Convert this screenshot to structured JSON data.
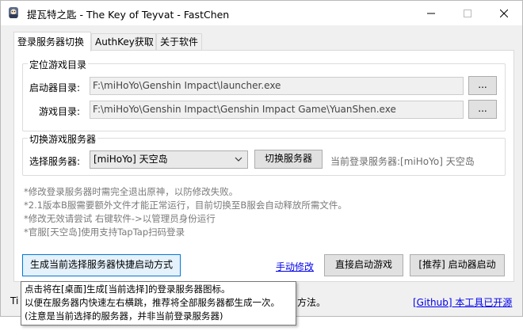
{
  "window": {
    "title": "提瓦特之匙 - The Key of Teyvat - FastChen"
  },
  "titlebar_buttons": {
    "minimize_icon": "minimize-icon",
    "maximize_icon": "maximize-icon",
    "close_icon": "close-icon"
  },
  "tabs": [
    {
      "label": "登录服务器切换",
      "active": true
    },
    {
      "label": "AuthKey获取",
      "active": false
    },
    {
      "label": "关于软件",
      "active": false
    }
  ],
  "locate_group": {
    "title": "定位游戏目录",
    "launcher_label": "启动器目录:",
    "launcher_value": "F:\\miHoYo\\Genshin Impact\\launcher.exe",
    "launcher_browse": "...",
    "game_label": "游戏目录:",
    "game_value": "F:\\miHoYo\\Genshin Impact\\Genshin Impact Game\\YuanShen.exe",
    "game_browse": "..."
  },
  "switch_group": {
    "title": "切换游戏服务器",
    "select_label": "选择服务器:",
    "selected_server": "[miHoYo] 天空岛",
    "switch_button": "切换服务器",
    "current_login": "当前登录服务器:[miHoYo] 天空岛"
  },
  "notes": [
    "*修改登录服务器时需完全退出原神，以防修改失败。",
    "*2.1版本B服需要额外文件才能正常运行，目前切换至B服会自动释放所需文件。",
    "*修改无效请尝试 右键软件->以管理员身份运行",
    "*官服[天空岛]使用支持TapTap扫码登录"
  ],
  "actions": {
    "create_shortcut": "生成当前选择服务器快捷启动方式",
    "manual_edit": "手动修改",
    "direct_launch": "直接启动游戏",
    "launcher_start": "[推荐] 启动器启动"
  },
  "statusbar": {
    "tip_prefix": "Ti",
    "tip_suffix": "方法。",
    "github_link": "[Github] 本工具已开源"
  },
  "tooltip": {
    "lines": [
      "点击将在[桌面]生成[当前选择]的登录服务器图标。",
      "以便在服务器内快速左右横跳，推荐将全部服务器都生成一次。",
      "(注意是当前选择的服务器，并非当前登录服务器)"
    ]
  }
}
